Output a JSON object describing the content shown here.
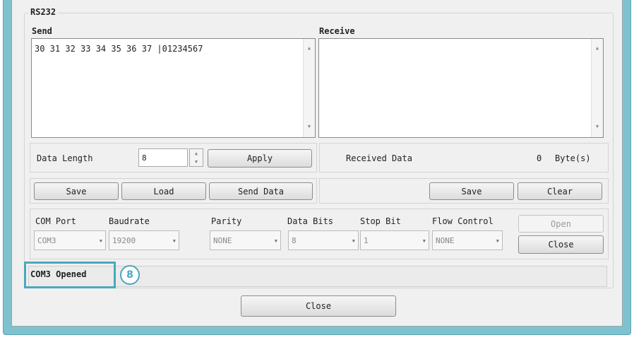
{
  "groupbox_title": "RS232",
  "send": {
    "label": "Send",
    "text": "30 31 32 33 34 35 36 37 |01234567"
  },
  "receive": {
    "label": "Receive",
    "text": ""
  },
  "data_length": {
    "label": "Data Length",
    "value": "8",
    "apply_label": "Apply"
  },
  "received_data": {
    "label": "Received Data",
    "count": "0",
    "unit": "Byte(s)"
  },
  "send_actions": {
    "save_label": "Save",
    "load_label": "Load",
    "send_data_label": "Send Data"
  },
  "receive_actions": {
    "save_label": "Save",
    "clear_label": "Clear"
  },
  "port_settings": {
    "com_port": {
      "label": "COM Port",
      "value": "COM3"
    },
    "baudrate": {
      "label": "Baudrate",
      "value": "19200"
    },
    "parity": {
      "label": "Parity",
      "value": "NONE"
    },
    "data_bits": {
      "label": "Data Bits",
      "value": "8"
    },
    "stop_bit": {
      "label": "Stop Bit",
      "value": "1"
    },
    "flow_control": {
      "label": "Flow Control",
      "value": "NONE"
    },
    "open_label": "Open",
    "close_label": "Close"
  },
  "status": {
    "text": "COM3 Opened"
  },
  "callout": {
    "number": "8",
    "color": "#4aa8bd"
  },
  "footer": {
    "close_label": "Close"
  },
  "icons": {
    "scroll_up": "scroll-up-icon",
    "scroll_down": "scroll-down-icon",
    "spin_up": "spin-up-icon",
    "spin_down": "spin-down-icon",
    "dropdown": "chevron-down-icon"
  }
}
